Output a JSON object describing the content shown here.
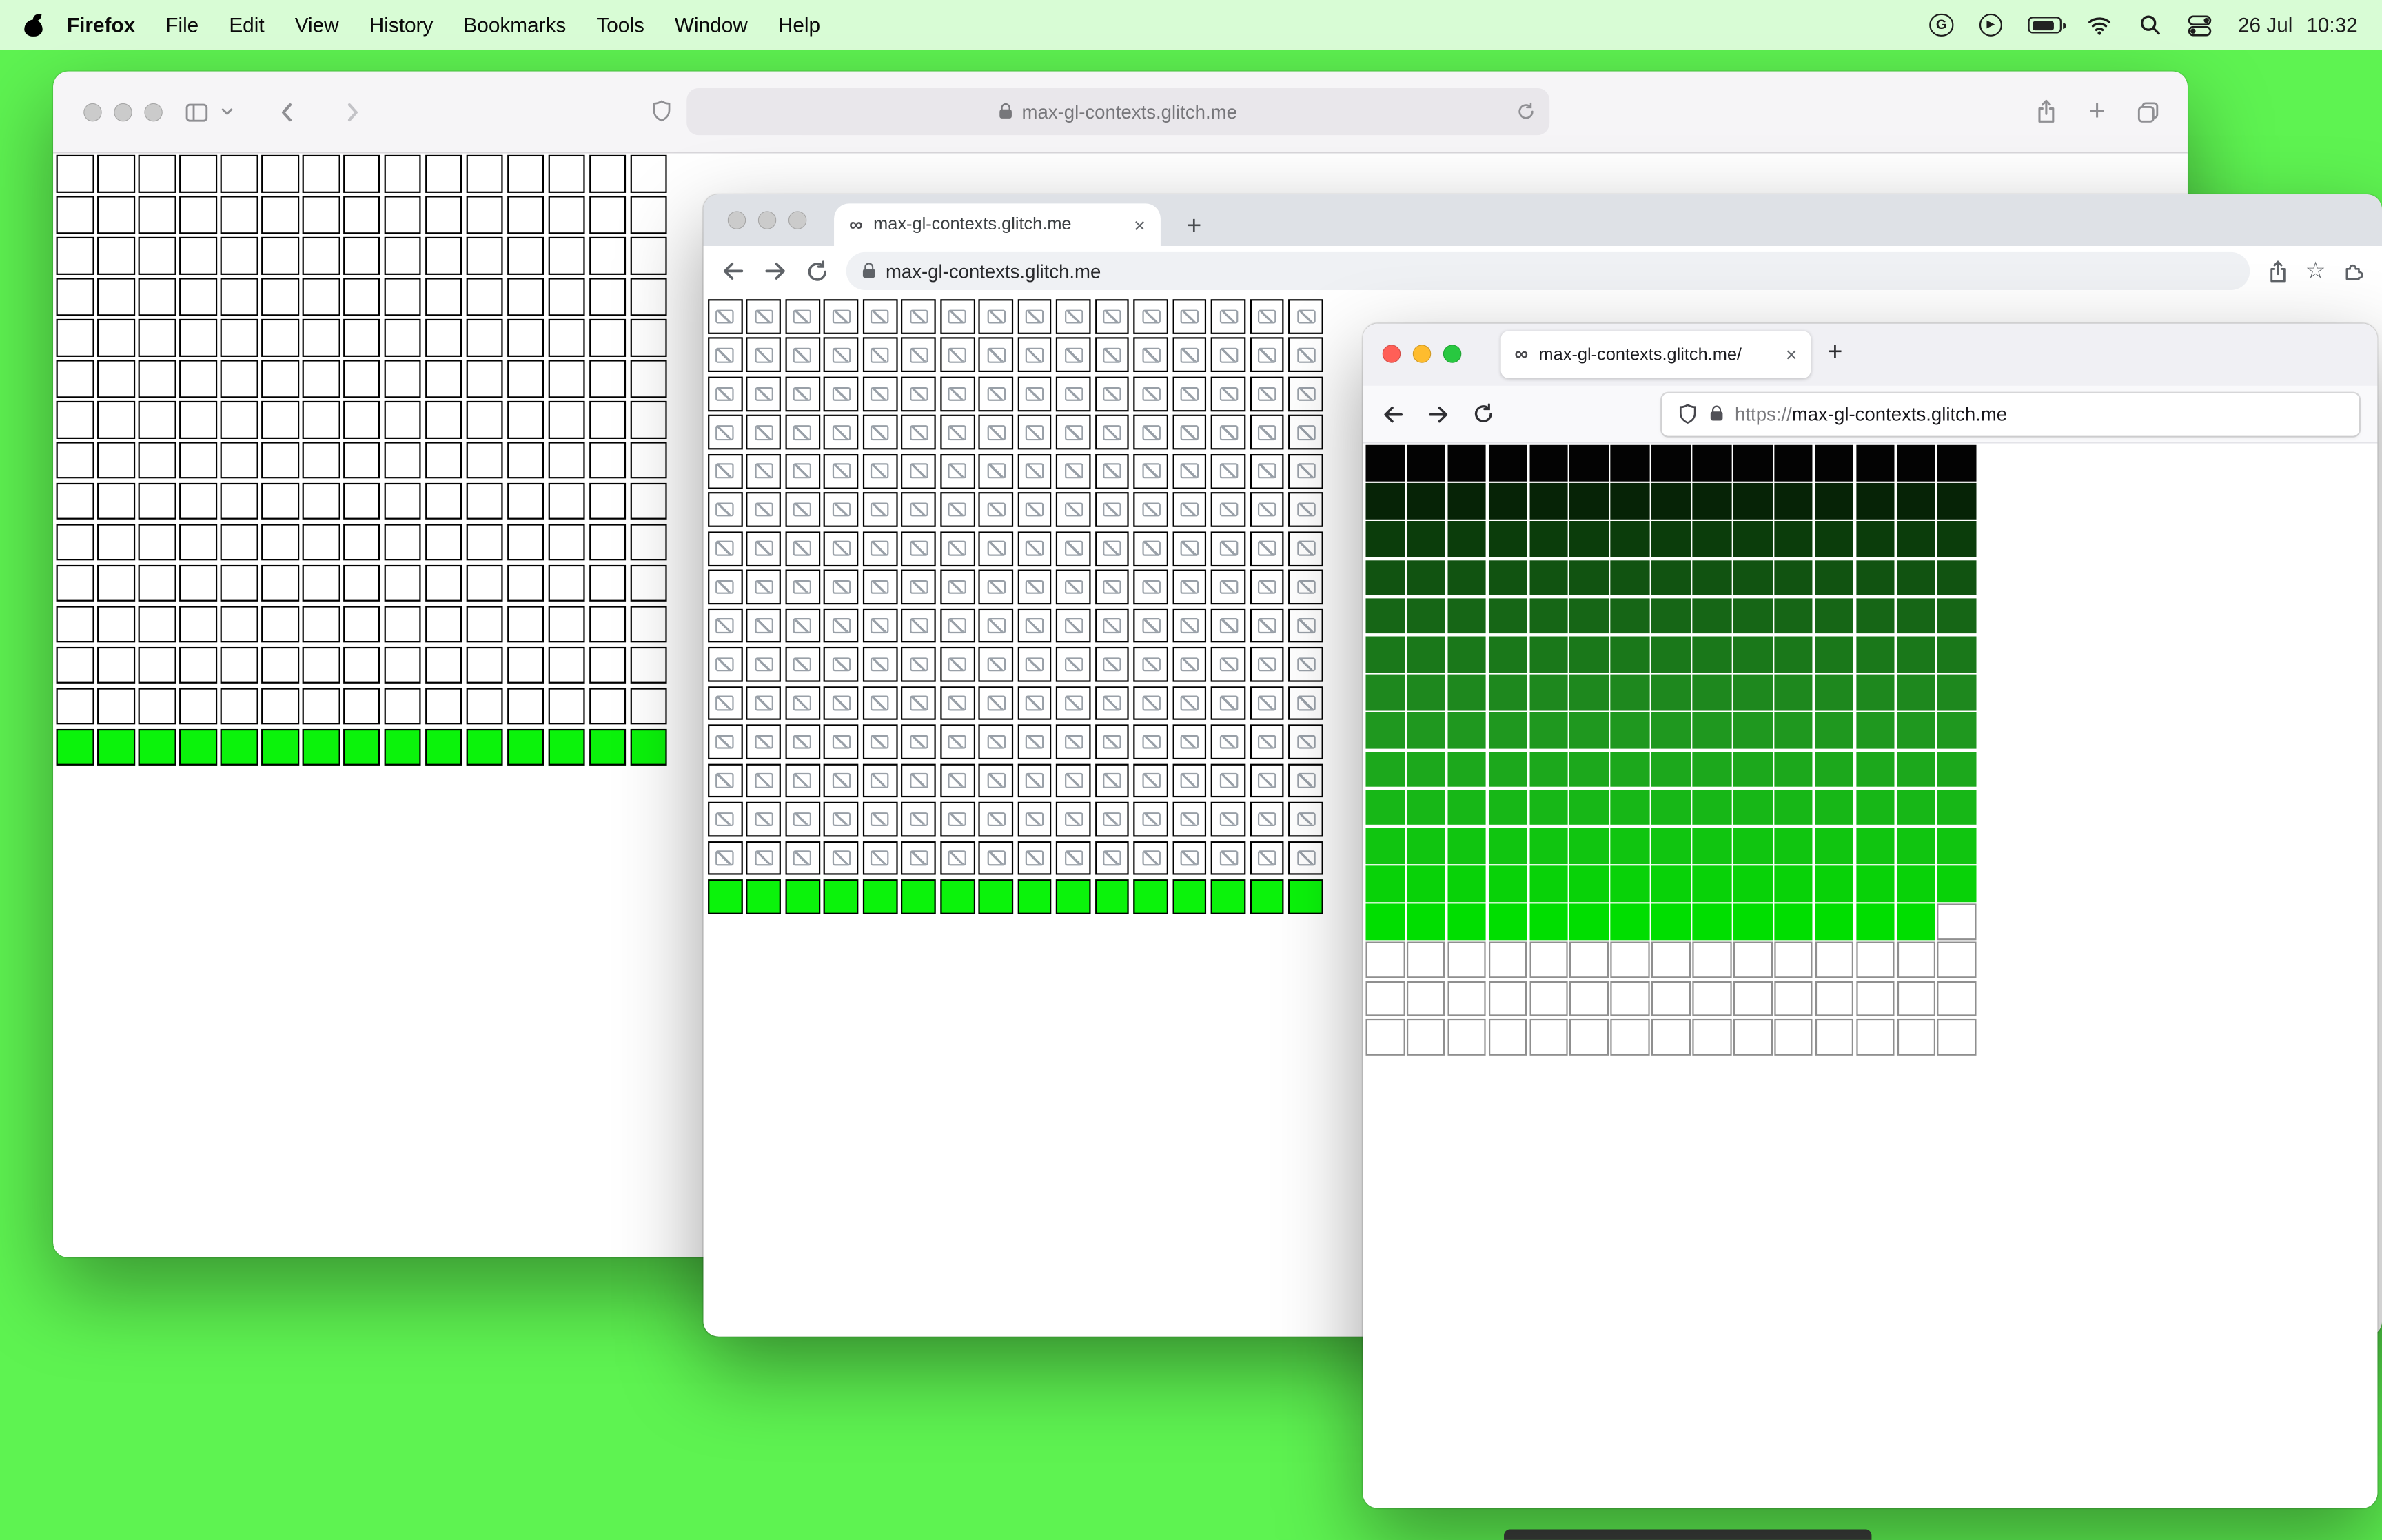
{
  "desktop": {
    "background_color": "#5ef351",
    "peek_bar_color": "#3a3d3a"
  },
  "menu_bar": {
    "app_name": "Firefox",
    "items": [
      "File",
      "Edit",
      "View",
      "History",
      "Bookmarks",
      "Tools",
      "Window",
      "Help"
    ],
    "date": "26 Jul",
    "time": "10:32"
  },
  "glyphs": {
    "favicon": "∞",
    "new_tab": "+",
    "close_tab": "×",
    "star": "☆",
    "play": "▶",
    "grammarly": "G"
  },
  "safari_window": {
    "url": "max-gl-contexts.glitch.me",
    "grid": {
      "cols": 15,
      "rows": 15,
      "green_rows": 1,
      "green_color": "#0bf30b",
      "cell_border_color": "#000000"
    }
  },
  "chrome_window": {
    "tab_title": "max-gl-contexts.glitch.me",
    "url": "max-gl-contexts.glitch.me",
    "grid": {
      "cols": 16,
      "rows": 16,
      "green_rows": 1,
      "green_color": "#0bf30b",
      "cell_border_color": "#000000"
    }
  },
  "firefox_window": {
    "tab_title": "max-gl-contexts.glitch.me/",
    "url_scheme": "https://",
    "url_host": "max-gl-contexts.glitch.me",
    "grid": {
      "cols": 15,
      "row_colors": [
        "#030303",
        "#062306",
        "#0b3d0b",
        "#115311",
        "#166616",
        "#1a781a",
        "#1e881e",
        "#1f981f",
        "#1ca81c",
        "#17b717",
        "#10c510",
        "#08d208",
        "#00de00"
      ],
      "missing_cells_in_last_colored_row": 1,
      "empty_rows": 3,
      "empty_cell_border_color": "#8f8f8f"
    }
  }
}
